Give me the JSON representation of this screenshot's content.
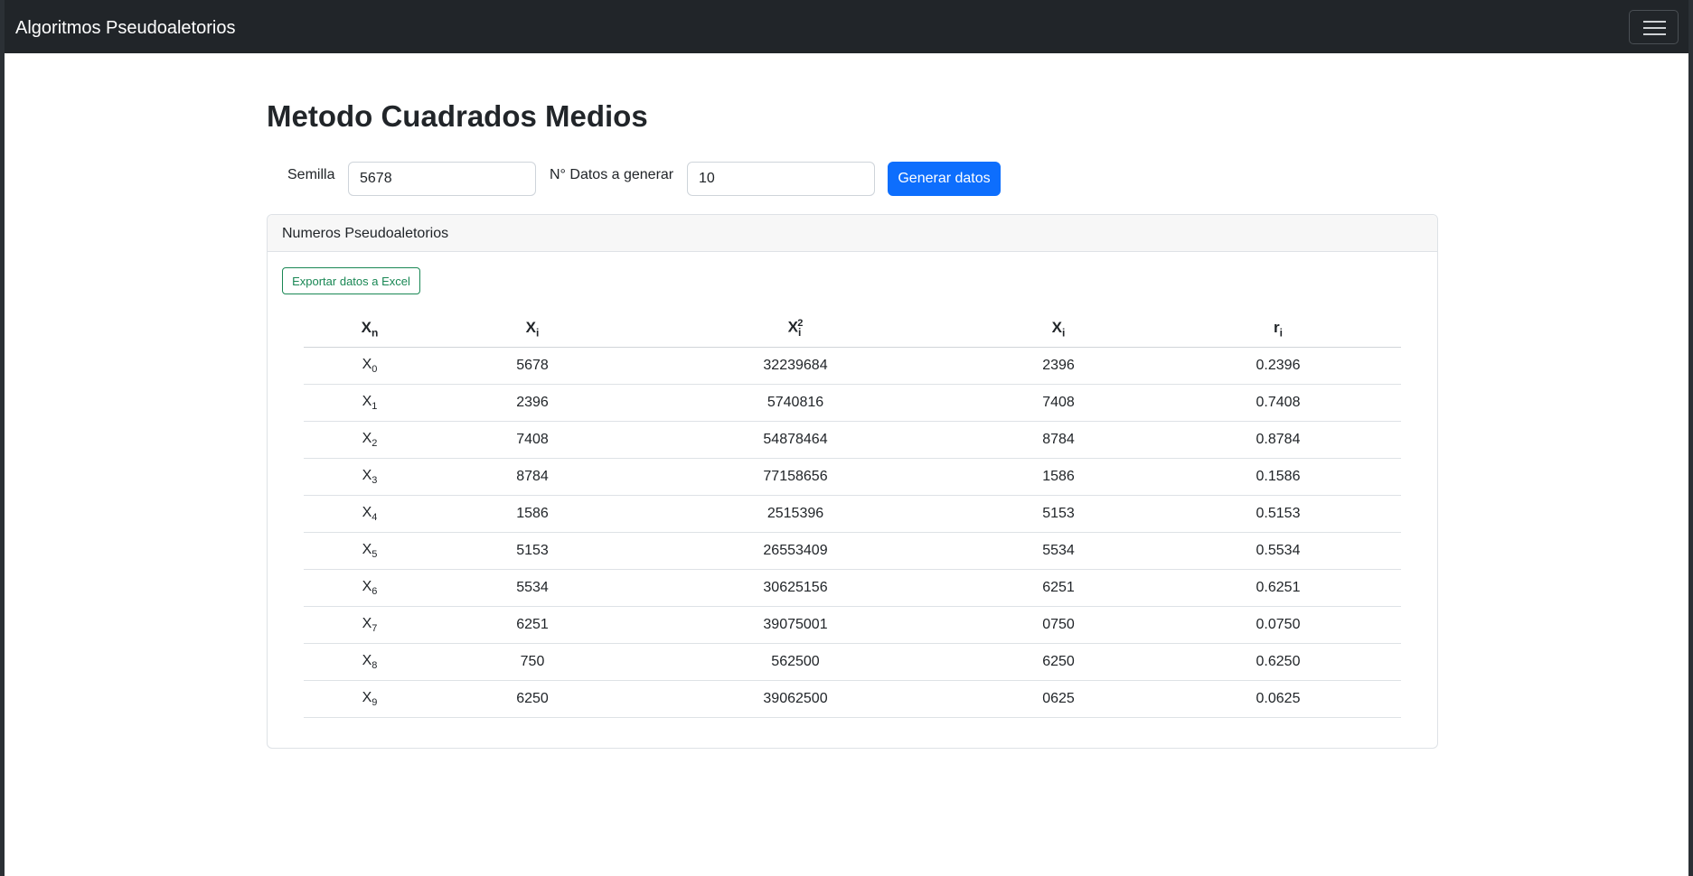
{
  "navbar": {
    "brand": "Algoritmos Pseudoaletorios"
  },
  "page": {
    "title": "Metodo Cuadrados Medios"
  },
  "form": {
    "seed_label": "Semilla",
    "seed_value": "5678",
    "count_label": "N° Datos a generar",
    "count_value": "10",
    "generate_label": "Generar datos"
  },
  "card": {
    "header": "Numeros Pseudoaletorios",
    "export_label": "Exportar datos a Excel"
  },
  "table": {
    "headers": [
      {
        "base": "X",
        "sub": "n",
        "sup": ""
      },
      {
        "base": "X",
        "sub": "i",
        "sup": ""
      },
      {
        "base": "X",
        "sub": "i",
        "sup": "2"
      },
      {
        "base": "X",
        "sub": "i",
        "sup": ""
      },
      {
        "base": "r",
        "sub": "i",
        "sup": ""
      }
    ],
    "rows": [
      {
        "n": "0",
        "xi": "5678",
        "xi2": "32239684",
        "x": "2396",
        "r": "0.2396"
      },
      {
        "n": "1",
        "xi": "2396",
        "xi2": "5740816",
        "x": "7408",
        "r": "0.7408"
      },
      {
        "n": "2",
        "xi": "7408",
        "xi2": "54878464",
        "x": "8784",
        "r": "0.8784"
      },
      {
        "n": "3",
        "xi": "8784",
        "xi2": "77158656",
        "x": "1586",
        "r": "0.1586"
      },
      {
        "n": "4",
        "xi": "1586",
        "xi2": "2515396",
        "x": "5153",
        "r": "0.5153"
      },
      {
        "n": "5",
        "xi": "5153",
        "xi2": "26553409",
        "x": "5534",
        "r": "0.5534"
      },
      {
        "n": "6",
        "xi": "5534",
        "xi2": "30625156",
        "x": "6251",
        "r": "0.6251"
      },
      {
        "n": "7",
        "xi": "6251",
        "xi2": "39075001",
        "x": "0750",
        "r": "0.0750"
      },
      {
        "n": "8",
        "xi": "750",
        "xi2": "562500",
        "x": "6250",
        "r": "0.6250"
      },
      {
        "n": "9",
        "xi": "6250",
        "xi2": "39062500",
        "x": "0625",
        "r": "0.0625"
      }
    ]
  }
}
